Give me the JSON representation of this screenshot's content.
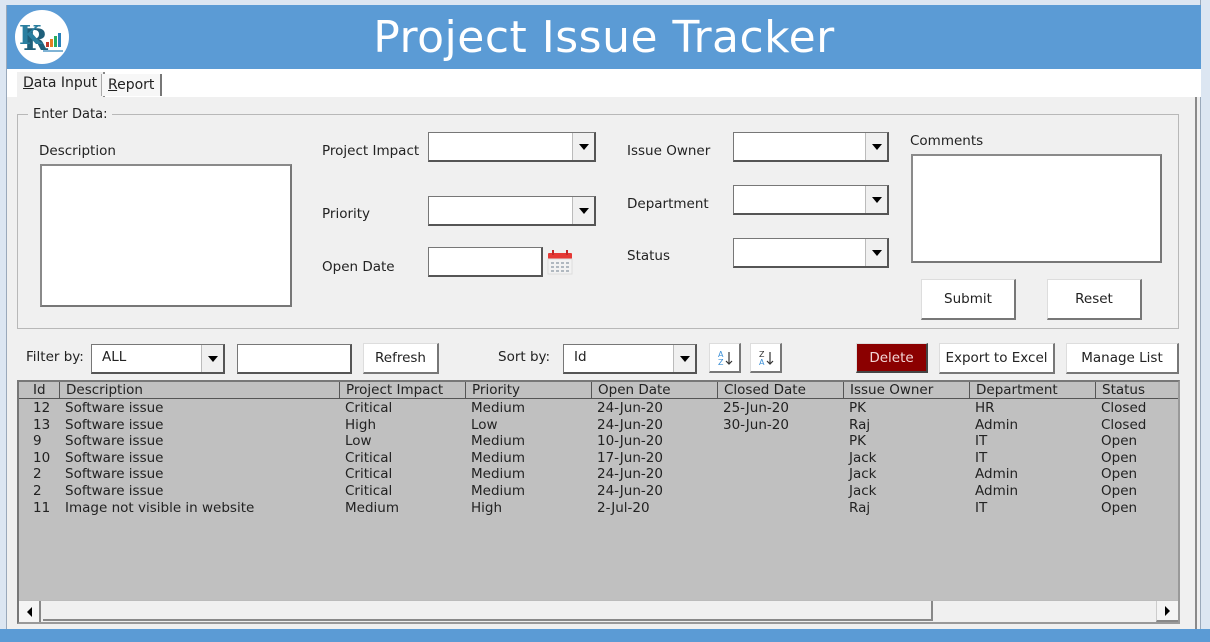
{
  "app": {
    "title": "Project Issue Tracker",
    "header_color": "#5b9bd5",
    "logo_icon": "rk-logo-icon"
  },
  "tabs": [
    {
      "label": "Data Input",
      "mnemonic": "D",
      "active": true
    },
    {
      "label": "Report",
      "mnemonic": "R",
      "active": false
    }
  ],
  "form": {
    "group_label": "Enter Data:",
    "description_label": "Description",
    "description_value": "",
    "project_impact_label": "Project Impact",
    "project_impact_value": "",
    "priority_label": "Priority",
    "priority_value": "",
    "open_date_label": "Open Date",
    "open_date_value": "",
    "calendar_icon": "calendar-icon",
    "issue_owner_label": "Issue Owner",
    "issue_owner_value": "",
    "department_label": "Department",
    "department_value": "",
    "status_label": "Status",
    "status_value": "",
    "comments_label": "Comments",
    "comments_value": "",
    "submit_label": "Submit",
    "reset_label": "Reset"
  },
  "toolbar": {
    "filter_label": "Filter by:",
    "filter_value": "ALL",
    "filter_text_value": "",
    "refresh_label": "Refresh",
    "sort_label": "Sort by:",
    "sort_value": "Id",
    "sort_asc_icon": "sort-ascending-icon",
    "sort_desc_icon": "sort-descending-icon",
    "delete_label": "Delete",
    "delete_color": "#8b0000",
    "export_label": "Export to Excel",
    "manage_label": "Manage List"
  },
  "table": {
    "columns": [
      "Id",
      "Description",
      "Project Impact",
      "Priority",
      "Open Date",
      "Closed Date",
      "Issue Owner",
      "Department",
      "Status"
    ],
    "rows": [
      [
        "12",
        "Software issue",
        "Critical",
        "Medium",
        "24-Jun-20",
        "25-Jun-20",
        "PK",
        "HR",
        "Closed"
      ],
      [
        "13",
        "Software issue",
        "High",
        "Low",
        "24-Jun-20",
        "30-Jun-20",
        "Raj",
        "Admin",
        "Closed"
      ],
      [
        "9",
        "Software issue",
        "Low",
        "Medium",
        "10-Jun-20",
        "",
        "PK",
        "IT",
        "Open"
      ],
      [
        "10",
        "Software issue",
        "Critical",
        "Medium",
        "17-Jun-20",
        "",
        "Jack",
        "IT",
        "Open"
      ],
      [
        "2",
        "Software issue",
        "Critical",
        "Medium",
        "24-Jun-20",
        "",
        "Jack",
        "Admin",
        "Open"
      ],
      [
        "2",
        "Software issue",
        "Critical",
        "Medium",
        "24-Jun-20",
        "",
        "Jack",
        "Admin",
        "Open"
      ],
      [
        "11",
        "Image not visible in website",
        "Medium",
        "High",
        "2-Jul-20",
        "",
        "Raj",
        "IT",
        "Open"
      ]
    ]
  }
}
